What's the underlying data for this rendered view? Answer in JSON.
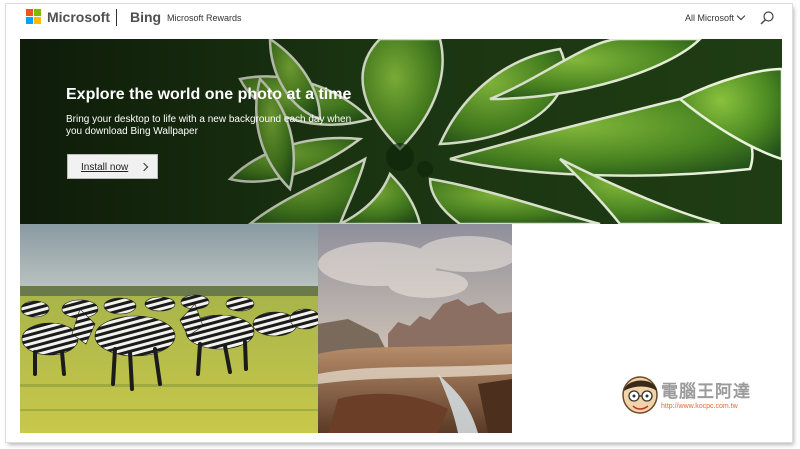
{
  "header": {
    "brand": "Microsoft",
    "product": "Bing",
    "nav_link": "Microsoft Rewards",
    "all_microsoft": "All Microsoft",
    "icons": [
      "microsoft-logo",
      "chevron-down-icon",
      "search-icon"
    ]
  },
  "hero": {
    "title": "Explore the world one photo at a time",
    "description": "Bring your desktop to life with a new background each day when you download Bing Wallpaper",
    "install_button": "Install now",
    "button_icon": "chevron-right-icon"
  },
  "tiles": [
    {
      "subject": "zebras-grassland"
    },
    {
      "subject": "canyon-waterfall"
    }
  ],
  "watermark": {
    "text": "電腦王阿達",
    "url": "http://www.kocpc.com.tw"
  },
  "colors": {
    "ms_red": "#f25022",
    "ms_green": "#7fba00",
    "ms_blue": "#00a4ef",
    "ms_yellow": "#ffb900",
    "watermark_url": "#e46b2c"
  }
}
